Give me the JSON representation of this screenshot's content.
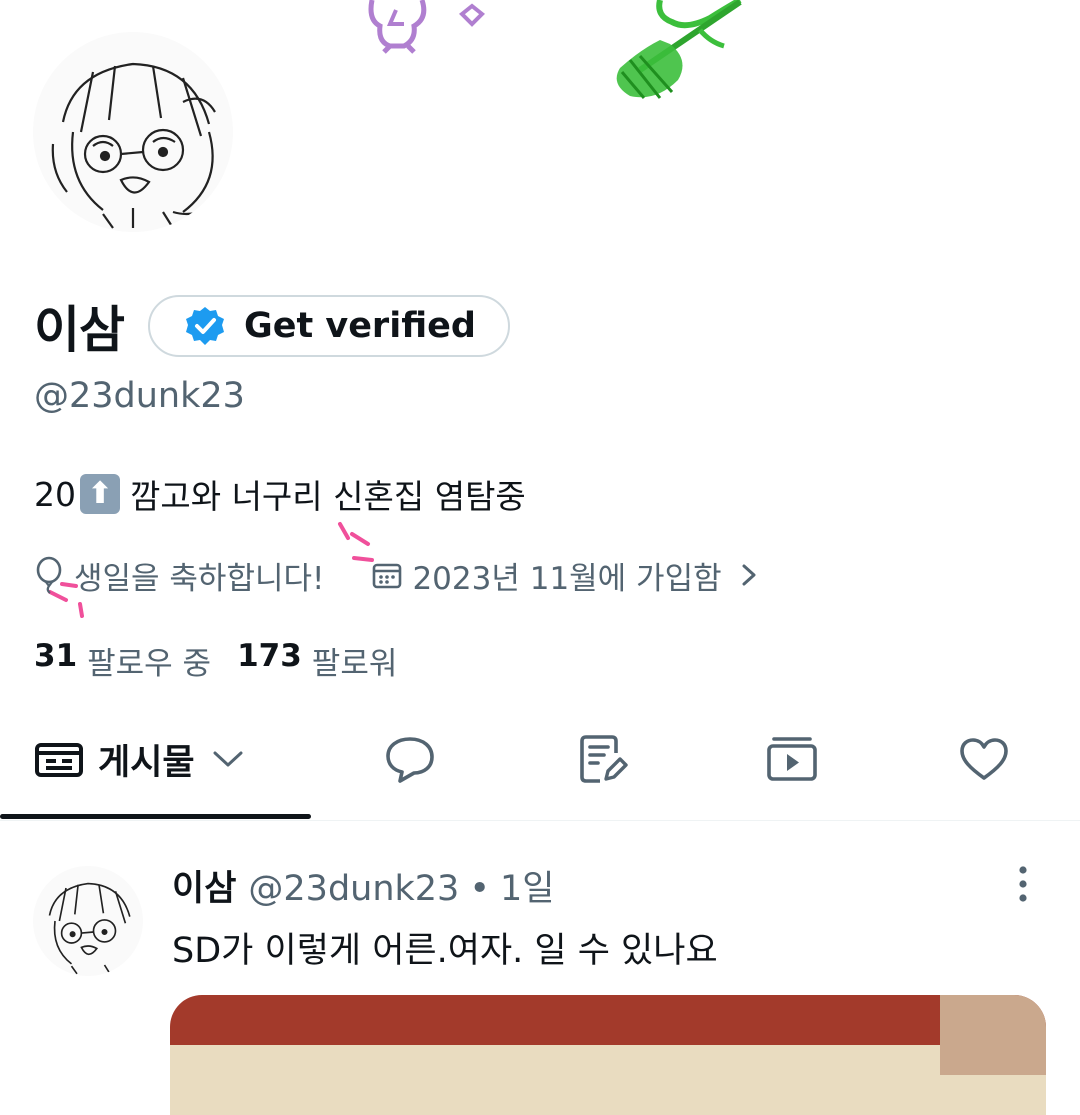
{
  "profile": {
    "display_name": "이삼",
    "handle": "@23dunk23",
    "verify_label": "Get verified",
    "bio_prefix": "20",
    "bio_emoji": "⬆",
    "bio_text": "깜고와 너구리 신혼집 염탐중",
    "birthday_text": "생일을 축하합니다!",
    "joined_text": "2023년 11월에 가입함",
    "following_count": "31",
    "following_label": "팔로우 중",
    "followers_count": "173",
    "followers_label": "팔로워"
  },
  "tabs": {
    "posts_label": "게시물",
    "items": [
      "posts",
      "replies",
      "articles",
      "media",
      "likes"
    ]
  },
  "tweet": {
    "name": "이삼",
    "handle": "@23dunk23",
    "dot": "•",
    "time": "1일",
    "text": "SD가 이렇게 어른.여자. 일 수 있나요"
  },
  "colors": {
    "text_primary": "#0f1419",
    "text_secondary": "#536471",
    "verified_blue": "#1d9bf0",
    "border": "#cfd9de",
    "birthday_pink": "#f0509b"
  }
}
